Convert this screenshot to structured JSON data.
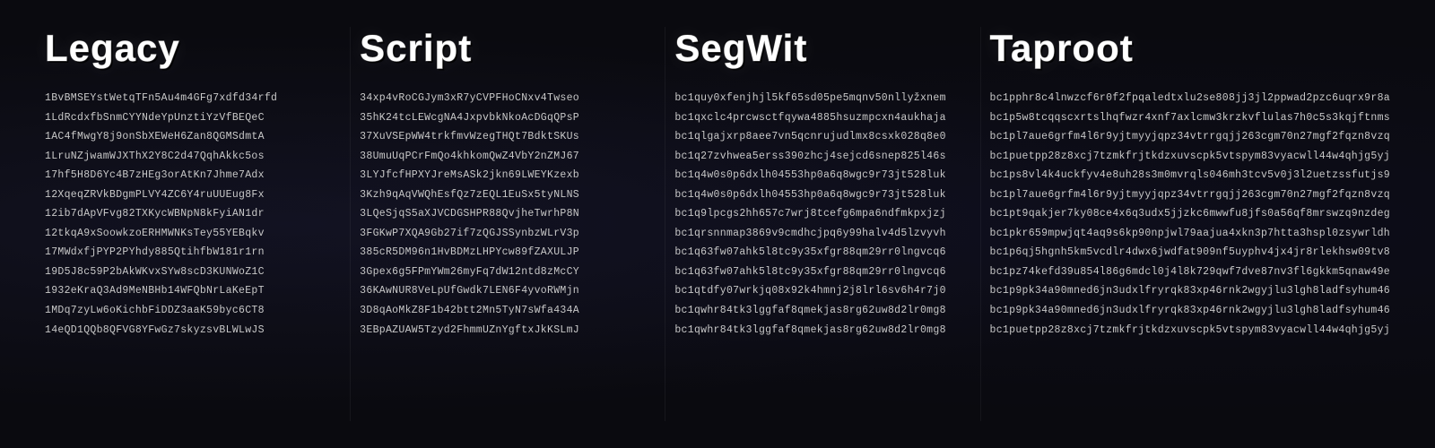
{
  "columns": [
    {
      "id": "legacy",
      "title": "Legacy",
      "addresses": [
        "1BvBMSEYstWetqTFn5Au4m4GFg7xdfd34rfd",
        "1LdRcdxfbSnmCYYNdeYpUnztiYzVfBEQeC",
        "1AC4fMwgY8j9onSbXEWeH6Zan8QGMSdmtA",
        "1LruNZjwamWJXThX2Y8C2d47QqhAkkc5os",
        "17hf5H8D6Yc4B7zHEg3orAtKn7Jhme7Adx",
        "12XqeqZRVkBDgmPLVY4ZC6Y4ruUUEug8Fx",
        "12ib7dApVFvg82TXKycWBNpN8kFyiAN1dr",
        "12tkqA9xSoowkzoERHMWNKsTey55YEBqkv",
        "17MWdxfjPYP2PYhdy885QtihfbW181r1rn",
        "19D5J8c59P2bAkWKvxSYw8scD3KUNWoZ1C",
        "1932eKraQ3Ad9MeNBHb14WFQbNrLaKeEpT",
        "1MDq7zyLw6oKichbFiDDZ3aaK59byc6CT8",
        "14eQD1QQb8QFVG8YFwGz7skyzsvBLWLwJS"
      ]
    },
    {
      "id": "script",
      "title": "Script",
      "addresses": [
        "34xp4vRoCGJym3xR7yCVPFHoCNxv4Twseo",
        "35hK24tcLEWcgNA4JxpvbkNkoAcDGqQPsP",
        "37XuVSEpWW4trkfmvWzegTHQt7BdktSKUs",
        "38UmuUqPCrFmQo4khkomQwZ4VbY2nZMJ67",
        "3LYJfcfHPXYJreMsASk2jkn69LWEYKzexb",
        "3Kzh9qAqVWQhEsfQz7zEQL1EuSx5tyNLNS",
        "3LQeSjqS5aXJVCDGSHPR88QvjheTwrhP8N",
        "3FGKwP7XQA9Gb27if7zQGJSSynbzWLrV3p",
        "385cR5DM96n1HvBDMzLHPYcw89fZAXULJP",
        "3Gpex6g5FPmYWm26myFq7dW12ntd8zMcCY",
        "36KAwNUR8VeLpUfGwdk7LEN6F4yvoRWMjn",
        "3D8qAoMkZ8F1b42btt2Mn5TyN7sWfa434A",
        "3EBpAZUAW5Tzyd2FhmmUZnYgftxJkKSLmJ"
      ]
    },
    {
      "id": "segwit",
      "title": "SegWit",
      "addresses": [
        "bc1quy0xfenjhjl5kf65sd05pe5mqnv50nllyžxnem",
        "bc1qxclc4prcwsctfqywa4885hsuzmpcxn4aukhaja",
        "bc1qlgajxrp8aee7vn5qcnrujudlmx8csxk028q8e0",
        "bc1q27zvhwea5erss390zhcj4sejcd6snep825l46s",
        "bc1q4w0s0p6dxlh04553hp0a6q8wgc9r73jt528luk",
        "bc1q4w0s0p6dxlh04553hp0a6q8wgc9r73jt528luk",
        "bc1q9lpcgs2hh657c7wrj8tcefg6mpa6ndfmkpxjzj",
        "bc1qrsnnmap3869v9cmdhcjpq6y99halv4d5lzvyvh",
        "bc1q63fw07ahk5l8tc9y35xfgr88qm29rr0lngvcq6",
        "bc1q63fw07ahk5l8tc9y35xfgr88qm29rr0lngvcq6",
        "bc1qtdfy07wrkjq08x92k4hmnj2j8lrl6sv6h4r7j0",
        "bc1qwhr84tk3lggfaf8qmekjas8rg62uw8d2lr0mg8",
        "bc1qwhr84tk3lggfaf8qmekjas8rg62uw8d2lr0mg8"
      ]
    },
    {
      "id": "taproot",
      "title": "Taproot",
      "addresses": [
        "bc1pphr8c4lnwzcf6r0f2fpqaledtxlu2se808jj3jl2ppwad2pzc6uqrx9r8a",
        "bc1p5w8tcqqscxrtslhqfwzr4xnf7axlcmw3krzkvflulas7h0c5s3kqjftnms",
        "bc1pl7aue6grfm4l6r9yjtmyyjqpz34vtrrgqjj263cgm70n27mgf2fqzn8vzq",
        "bc1puetpp28z8xcj7tzmkfrjtkdzxuvscpk5vtspym83vyacwll44w4qhjg5yj",
        "bc1ps8vl4k4uckfyv4e8uh28s3m0mvrqls046mh3tcv5v0j3l2uetzssfutjs9",
        "bc1pl7aue6grfm4l6r9yjtmyyjqpz34vtrrgqjj263cgm70n27mgf2fqzn8vzq",
        "bc1pt9qakjer7ky08ce4x6q3udx5jjzkc6mwwfu8jfs0a56qf8mrswzq9nzdeg",
        "bc1pkr659mpwjqt4aq9s6kp90npjwl79aajua4xkn3p7htta3hspl0zsywrldh",
        "bc1p6qj5hgnh5km5vcdlr4dwx6jwdfat909nf5uyphv4jx4jr8rlekhsw09tv8",
        "bc1pz74kefd39u854l86g6mdcl0j4l8k729qwf7dve87nv3fl6gkkm5qnaw49e",
        "bc1p9pk34a90mned6jn3udxlfryrqk83xp46rnk2wgyjlu3lgh8ladfsyhum46",
        "bc1p9pk34a90mned6jn3udxlfryrqk83xp46rnk2wgyjlu3lgh8ladfsyhum46",
        "bc1puetpp28z8xcj7tzmkfrjtkdzxuvscpk5vtspym83vyacwll44w4qhjg5yj"
      ]
    }
  ]
}
